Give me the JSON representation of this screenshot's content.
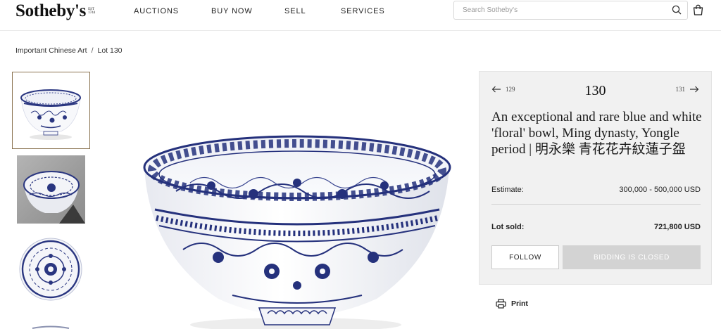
{
  "header": {
    "logo": "Sotheby's",
    "logo_est": "EST 1744",
    "nav": [
      "AUCTIONS",
      "BUY NOW",
      "SELL",
      "SERVICES"
    ],
    "search_placeholder": "Search Sotheby's",
    "search_icon": "search-icon",
    "bag_icon": "shopping-bag-icon"
  },
  "breadcrumb": {
    "items": [
      "Important Chinese Art",
      "Lot 130"
    ],
    "separator": "/"
  },
  "gallery": {
    "thumbnails": [
      "bowl-front-view",
      "bowl-interior-view",
      "bowl-top-view",
      "bowl-detail-view"
    ],
    "main_image": "blue-and-white-floral-bowl"
  },
  "lot": {
    "prev_number": "129",
    "number": "130",
    "next_number": "131",
    "title": "An exceptional and rare blue and white 'floral' bowl, Ming dynasty, Yongle period | 明永樂 青花花卉紋蓮子盌",
    "estimate_label": "Estimate:",
    "estimate_value": "300,000 - 500,000 USD",
    "sold_label": "Lot sold:",
    "sold_value": "721,800 USD",
    "follow_label": "FOLLOW",
    "bidding_label": "BIDDING IS CLOSED",
    "print_label": "Print"
  },
  "colors": {
    "panel_bg": "#f1f1f1",
    "thumb_border": "#8a7250",
    "cobalt": "#23307a",
    "disabled_button": "#d3d3d3"
  }
}
